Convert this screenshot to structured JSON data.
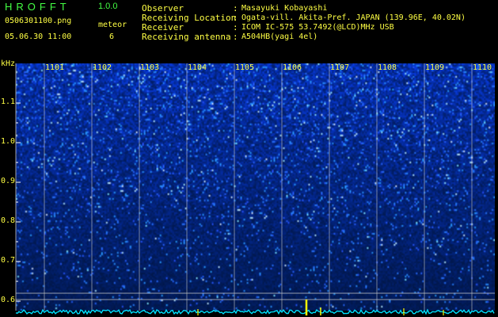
{
  "header": {
    "app_title": "HROFFT",
    "app_version": "1.0.0",
    "file_name": "0506301100.png",
    "detect_label": "meteor",
    "datetime": "05.06.30 11:00",
    "detect_count": "6"
  },
  "info": [
    {
      "label": "Observer",
      "value": "Masayuki Kobayashi"
    },
    {
      "label": "Receiving Location",
      "value": "Ogata-vill. Akita-Pref. JAPAN (139.96E, 40.02N)"
    },
    {
      "label": "Receiver",
      "value": "ICOM IC-575 53.7492(@LCD)MHz USB"
    },
    {
      "label": "Receiving antenna",
      "value": "A504HB(yagi 4el)"
    }
  ],
  "chart_data": {
    "type": "heatmap",
    "title": "",
    "ylabel": "kHz",
    "ylim": [
      0.6,
      1.1
    ],
    "y_ticks": [
      "1.1",
      "1.0",
      "0.9",
      "0.8",
      "0.7",
      "0.6"
    ],
    "x_ticks": [
      "1101",
      "1102",
      "1103",
      "1104",
      "1105",
      "1106",
      "1107",
      "1108",
      "1109",
      "1110"
    ],
    "colors": {
      "background": "#000000",
      "noise_low": "#0a1690",
      "noise_high": "#2a4cff",
      "hot": "#99ffff",
      "signal": "#ffff00",
      "trace": "#00e0ff",
      "grid": "#c8c8c8"
    }
  }
}
